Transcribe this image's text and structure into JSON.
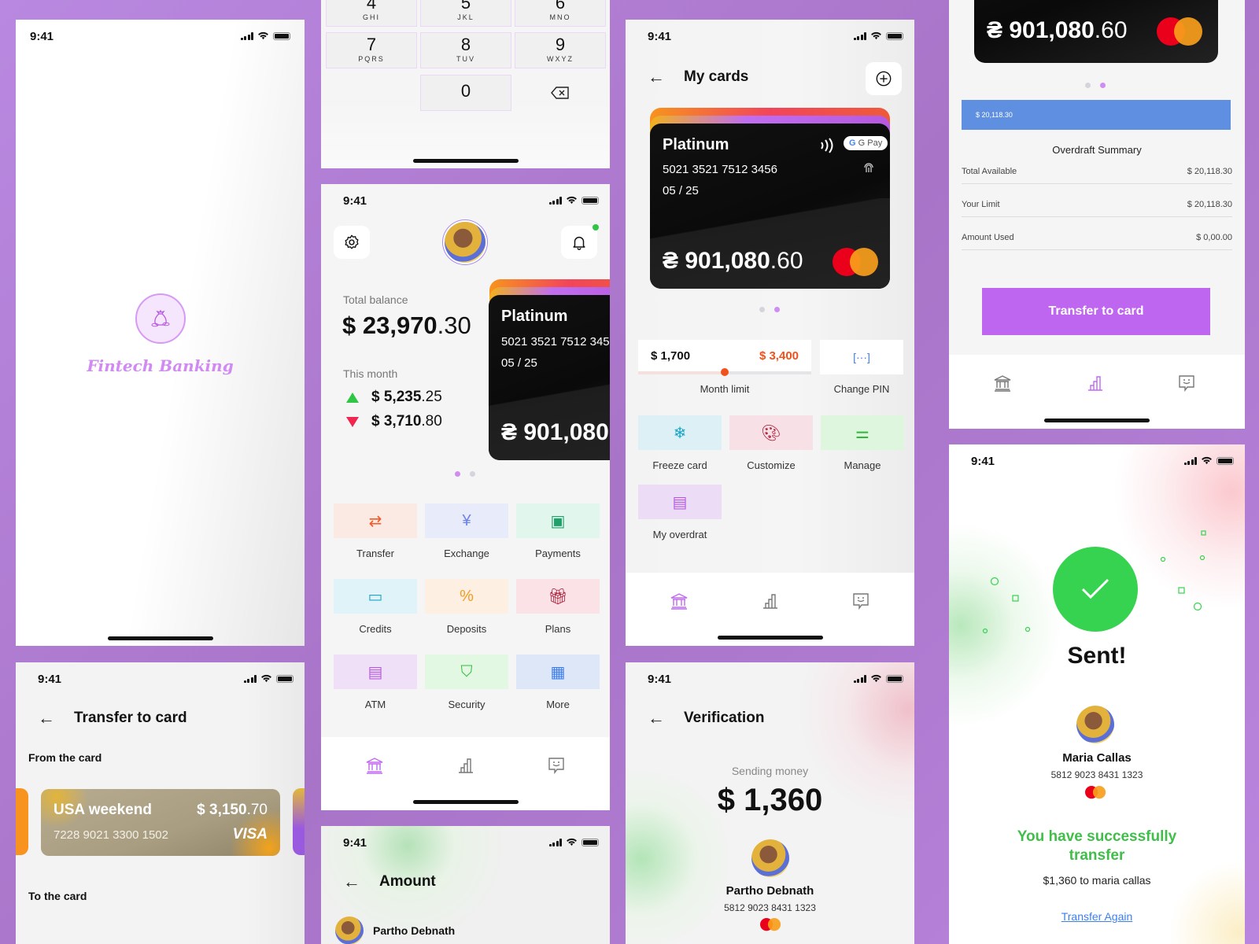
{
  "status_bar": {
    "time": "9:41"
  },
  "splash": {
    "logo_icon": "money-bag-icon",
    "brand_name": "Fintech Banking"
  },
  "keypad": {
    "keys": [
      {
        "digit": "4",
        "letters": "GHI"
      },
      {
        "digit": "5",
        "letters": "JKL"
      },
      {
        "digit": "6",
        "letters": "MNO"
      },
      {
        "digit": "7",
        "letters": "PQRS"
      },
      {
        "digit": "8",
        "letters": "TUV"
      },
      {
        "digit": "9",
        "letters": "WXYZ"
      },
      {
        "digit": "0",
        "letters": ""
      }
    ],
    "delete_icon": "backspace-icon"
  },
  "home": {
    "settings_icon": "gear-icon",
    "notification_icon": "bell-icon",
    "total_balance_label": "Total balance",
    "total_balance_main": "$ 23,970",
    "total_balance_cents": ".30",
    "this_month_label": "This month",
    "income_main": "$ 5,235",
    "income_cents": ".25",
    "expense_main": "$ 3,710",
    "expense_cents": ".80",
    "card": {
      "name": "Platinum",
      "number": "5021 3521 7512 345",
      "expiry": "05 / 25",
      "balance_main": "₴ 901,080"
    },
    "carousel_active_index": 0,
    "services": [
      {
        "label": "Transfer",
        "icon": "⇄",
        "icon_name": "transfer-arrows-icon",
        "bg": "#fbe9e3",
        "fg": "#f05a28"
      },
      {
        "label": "Exchange",
        "icon": "¥",
        "icon_name": "yen-icon",
        "bg": "#e7ebfa",
        "fg": "#6f82e8"
      },
      {
        "label": "Payments",
        "icon": "▣",
        "icon_name": "wallet-icon",
        "bg": "#e1f7ee",
        "fg": "#22a06b"
      },
      {
        "label": "Credits",
        "icon": "▭",
        "icon_name": "credit-card-icon",
        "bg": "#e0f3f8",
        "fg": "#1fa3c8"
      },
      {
        "label": "Deposits",
        "icon": "%",
        "icon_name": "percent-icon",
        "bg": "#fdefe1",
        "fg": "#f59a22"
      },
      {
        "label": "Plans",
        "icon": "🎁︎",
        "icon_name": "gift-icon",
        "bg": "#fbe2e7",
        "fg": "#a8132f"
      },
      {
        "label": "ATM",
        "icon": "▤",
        "icon_name": "cash-icon",
        "bg": "#efdff7",
        "fg": "#b65ae0"
      },
      {
        "label": "Security",
        "icon": "⛉",
        "icon_name": "shield-check-icon",
        "bg": "#e2f8e2",
        "fg": "#2fbf3a"
      },
      {
        "label": "More",
        "icon": "▦",
        "icon_name": "grid-icon",
        "bg": "#dee7f8",
        "fg": "#3d7ff0"
      }
    ]
  },
  "tab_bar": {
    "items": [
      {
        "name": "bank",
        "icon": "bank-icon"
      },
      {
        "name": "stats",
        "icon": "bar-chart-icon"
      },
      {
        "name": "support",
        "icon": "chat-smile-icon"
      }
    ]
  },
  "my_cards": {
    "title": "My cards",
    "add_icon": "plus-circle-icon",
    "card": {
      "name": "Platinum",
      "number": "5021 3521 7512 3456",
      "expiry": "05 / 25",
      "balance_main": "₴ 901,080",
      "balance_cents": ".60",
      "wallet_badge": "G Pay",
      "contactless_icon": "contactless-icon",
      "fingerprint_icon": "fingerprint-icon",
      "network": "mastercard"
    },
    "carousel_active_index": 1,
    "month_limit": {
      "spent": "$ 1,700",
      "limit": "$ 3,400",
      "progress": 0.5,
      "label": "Month limit"
    },
    "change_pin": {
      "label": "Change PIN",
      "icon": "[···]"
    },
    "actions": [
      {
        "label": "Freeze card",
        "icon": "❄",
        "icon_name": "snowflake-icon",
        "bg": "#dcf0f6",
        "fg": "#1aa3c7"
      },
      {
        "label": "Customize",
        "icon": "🎨︎",
        "icon_name": "palette-icon",
        "bg": "#f8e1e6",
        "fg": "#a8132f"
      },
      {
        "label": "Manage",
        "icon": "⚌",
        "icon_name": "sliders-icon",
        "bg": "#ddf6dd",
        "fg": "#30b83a"
      },
      {
        "label": "My overdrat",
        "icon": "▤",
        "icon_name": "cash-icon",
        "bg": "#ecdcf5",
        "fg": "#b65ae0"
      }
    ]
  },
  "overdraft": {
    "card_balance_main": "₴ 901,080",
    "card_balance_cents": ".60",
    "carousel_active_index": 1,
    "bar_amount": "$ 20,118.30",
    "summary_title": "Overdraft Summary",
    "rows": [
      {
        "label": "Total Available",
        "value": "$ 20,118.30"
      },
      {
        "label": "Your Limit",
        "value": "$ 20,118.30"
      },
      {
        "label": "Amount Used",
        "value": "$ 0,00.00"
      }
    ],
    "cta": "Transfer to card",
    "active_tab": 1
  },
  "sent": {
    "check_icon": "checkmark-icon",
    "title": "Sent!",
    "recipient_name": "Maria Callas",
    "recipient_card": "5812 9023 8431 1323",
    "success_line": "You have successfully transfer",
    "summary": "$1,360 to maria callas",
    "again_link": "Transfer Again"
  },
  "transfer": {
    "title": "Transfer to card",
    "from_label": "From the card",
    "card": {
      "name": "USA weekend",
      "balance_main": "$ 3,150",
      "balance_cents": ".70",
      "number": "7228 9021 3300 1502",
      "network": "VISA"
    },
    "to_label": "To the card"
  },
  "amount": {
    "title": "Amount",
    "recipient_partial": "Partho Debnath"
  },
  "verification": {
    "title": "Verification",
    "sending_label": "Sending money",
    "amount": "$ 1,360",
    "recipient_name": "Partho Debnath",
    "recipient_card": "5812 9023 8431 1323"
  },
  "colors": {
    "accent": "#bf66f0",
    "success": "#35d34f",
    "income": "#2fc545",
    "expense": "#f0264f",
    "limit": "#f1511b",
    "overdraft_bar": "#5e8fe0"
  }
}
